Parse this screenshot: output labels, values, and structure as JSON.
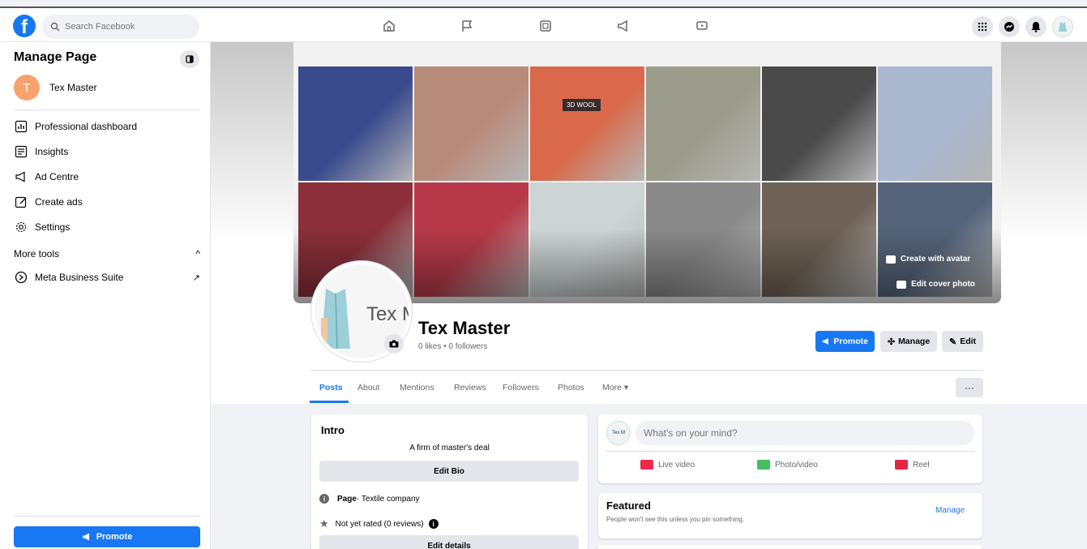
{
  "topbar": {
    "logo": "f",
    "search_placeholder": "Search Facebook",
    "nav_icons": [
      "home-icon",
      "flag-icon",
      "video-icon",
      "megaphone-icon",
      "gaming-icon"
    ],
    "right_icons": [
      "menu-grid-icon",
      "messenger-icon",
      "notifications-icon",
      "profile-avatar"
    ]
  },
  "sidebar": {
    "title": "Manage Page",
    "page": {
      "initial": "T",
      "name": "Tex Master"
    },
    "items": [
      {
        "label": "Professional dashboard",
        "icon": "dashboard-icon"
      },
      {
        "label": "Insights",
        "icon": "insights-icon"
      },
      {
        "label": "Ad Centre",
        "icon": "megaphone-icon"
      },
      {
        "label": "Create ads",
        "icon": "edit-icon"
      },
      {
        "label": "Settings",
        "icon": "gear-icon"
      }
    ],
    "more_tools": {
      "label": "More tools",
      "chevron": "^"
    },
    "tools": [
      {
        "label": "Meta Business Suite",
        "arrow": "↗"
      }
    ],
    "promote_label": "Promote"
  },
  "cover": {
    "create_avatar": "Create with avatar",
    "edit_cover": "Edit cover photo",
    "tile_colors": [
      "#3a4a8c",
      "#b78b7a",
      "#d9694a",
      "#9c9c8c",
      "#4a4a4a",
      "#a9b7cf",
      "#8b2f3a",
      "#b83a4a",
      "#cdd4d4",
      "#8a8a8a",
      "#6e6256",
      "#55647a"
    ],
    "tile_label": "3D WOOL"
  },
  "profile": {
    "pic_text": "Tex M",
    "name": "Tex Master",
    "stats": "0 likes • 0 followers"
  },
  "actions": {
    "promote": "Promote",
    "manage": "Manage",
    "edit": "Edit"
  },
  "tabs": [
    "Posts",
    "About",
    "Mentions",
    "Reviews",
    "Followers",
    "Photos",
    "More ▾"
  ],
  "more_menu": "···",
  "intro": {
    "title": "Intro",
    "bio": "A firm of master's deal",
    "edit_bio": "Edit Bio",
    "page_type_label": "Page",
    "page_type_value": " · Textile company",
    "rating": "Not yet rated (0 reviews)",
    "edit_details": "Edit details"
  },
  "composer": {
    "avatar_text": "Tex M",
    "placeholder": "What's on your mind?",
    "actions": [
      "Live video",
      "Photo/video",
      "Reel"
    ]
  },
  "featured": {
    "title": "Featured",
    "subtitle": "People won't see this unless you pin something.",
    "manage": "Manage"
  },
  "colors": {
    "accent": "#1877f2",
    "live": "#f02849",
    "photo": "#45bd62",
    "reel": "#e42645"
  }
}
